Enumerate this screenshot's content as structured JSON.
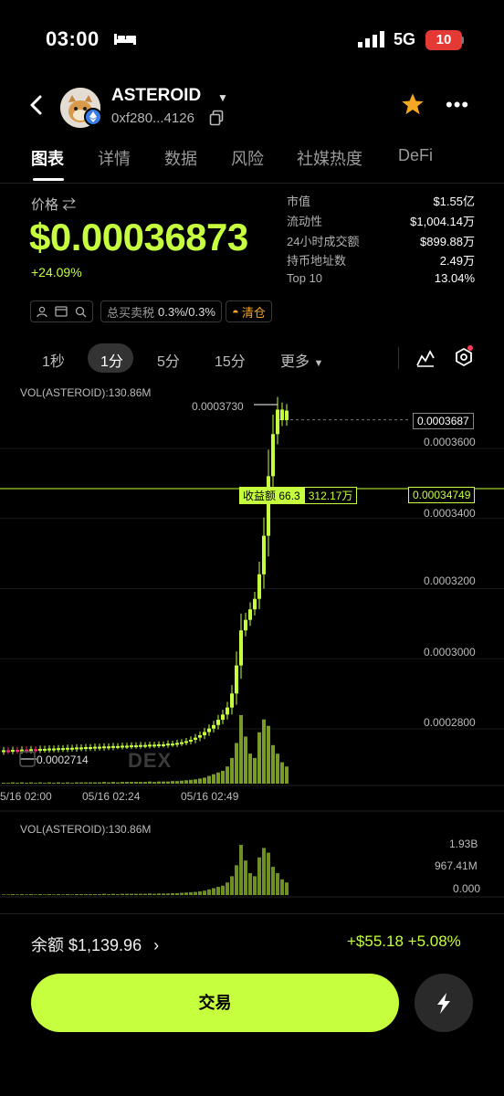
{
  "status": {
    "time": "03:00",
    "network": "5G",
    "battery": "10"
  },
  "token": {
    "name": "ASTEROID",
    "address": "0xf280...4126"
  },
  "tabs": [
    "图表",
    "详情",
    "数据",
    "风险",
    "社媒热度",
    "DeFi"
  ],
  "price": {
    "label": "价格",
    "value": "$0.00036873",
    "change": "+24.09%"
  },
  "stats": [
    {
      "k": "市值",
      "v": "$1.55亿"
    },
    {
      "k": "流动性",
      "v": "$1,004.14万"
    },
    {
      "k": "24小时成交额",
      "v": "$899.88万"
    },
    {
      "k": "持币地址数",
      "v": "2.49万"
    },
    {
      "k": "Top 10",
      "v": "13.04%"
    }
  ],
  "chips": {
    "tax_label": "总买卖税",
    "tax_value": "0.3%/0.3%",
    "clear": "清仓"
  },
  "timeframes": [
    "1秒",
    "1分",
    "5分",
    "15分",
    "更多"
  ],
  "chart_data": {
    "type": "candlestick",
    "top_label": "VOL(ASTEROID):130.86M",
    "watermark": "DEX",
    "price_ticks": [
      "0.0003600",
      "0.0003400",
      "0.0003200",
      "0.0003000",
      "0.0002800"
    ],
    "current_price": "0.0003687",
    "high_label": "0.0003730",
    "low_label": "0.0002714",
    "position_line": {
      "label": "收益额",
      "amount": "66.3",
      "value": "312.17万",
      "price": "0.00034749"
    },
    "x_labels": [
      "5/16 02:00",
      "05/16 02:24",
      "05/16 02:49"
    ],
    "closes": [
      0.0002718,
      0.0002716,
      0.0002719,
      0.0002717,
      0.000272,
      0.0002718,
      0.0002721,
      0.0002719,
      0.0002722,
      0.000272,
      0.0002723,
      0.0002721,
      0.0002724,
      0.0002722,
      0.0002725,
      0.0002723,
      0.0002726,
      0.0002724,
      0.0002727,
      0.0002725,
      0.0002728,
      0.0002726,
      0.0002729,
      0.0002727,
      0.000273,
      0.0002729,
      0.0002731,
      0.000273,
      0.0002732,
      0.0002731,
      0.0002733,
      0.0002732,
      0.0002734,
      0.0002733,
      0.0002735,
      0.0002734,
      0.0002737,
      0.0002736,
      0.0002739,
      0.0002741,
      0.0002744,
      0.0002748,
      0.0002754,
      0.0002761,
      0.000277,
      0.000278,
      0.000279,
      0.0002805,
      0.000282,
      0.000284,
      0.000288,
      0.000296,
      0.000306,
      0.000309,
      0.000312,
      0.000315,
      0.000322,
      0.000333,
      0.00035,
      0.000362,
      0.000369,
      0.000366,
      0.0003687
    ],
    "volumes": [
      2,
      2,
      3,
      2,
      3,
      2,
      3,
      2,
      3,
      2,
      3,
      2,
      3,
      2,
      3,
      2,
      3,
      3,
      3,
      3,
      3,
      3,
      4,
      3,
      4,
      3,
      4,
      4,
      4,
      4,
      4,
      4,
      5,
      4,
      5,
      5,
      5,
      6,
      6,
      7,
      8,
      9,
      10,
      12,
      14,
      18,
      22,
      26,
      30,
      40,
      60,
      95,
      160,
      110,
      70,
      60,
      120,
      150,
      135,
      90,
      70,
      50,
      40
    ],
    "vol_panel_label": "VOL(ASTEROID):130.86M",
    "vol_ticks": [
      "1.93B",
      "967.41M",
      "0.000"
    ]
  },
  "bottom": {
    "balance": "余额 $1,139.96",
    "pnl": "+$55.18 +5.08%",
    "trade": "交易"
  },
  "colors": {
    "accent": "#c6ff3d",
    "down": "#ff2d78"
  }
}
